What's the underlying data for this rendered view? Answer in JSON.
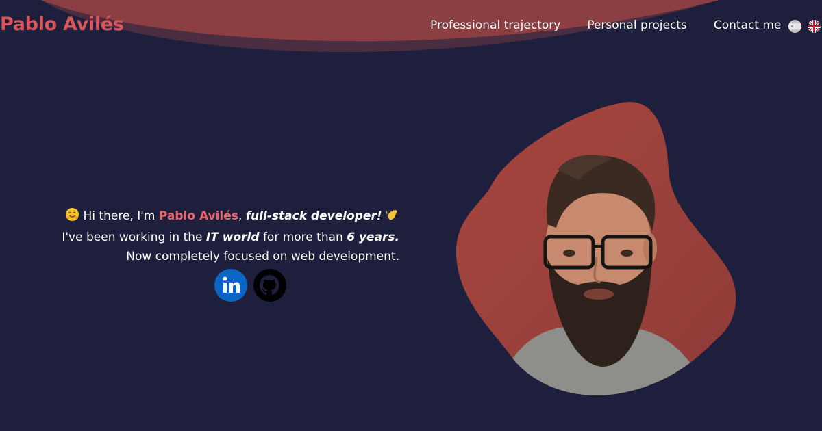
{
  "header": {
    "logo": "Pablo Avilés",
    "nav": [
      {
        "label": "Professional trajectory"
      },
      {
        "label": "Personal projects"
      },
      {
        "label": "Contact me"
      }
    ],
    "languages": [
      {
        "icon": "spain-flag-icon"
      },
      {
        "icon": "uk-flag-icon"
      }
    ]
  },
  "intro": {
    "line1_a": "Hi there, I'm ",
    "line1_name": "Pablo Avilés",
    "line1_b": ", ",
    "line1_role": "full-stack developer!",
    "line2_a": "I've been working in the ",
    "line2_it": "IT world",
    "line2_b": " for more than ",
    "line2_years": "6 years.",
    "line3": "Now completely focused on web development.",
    "emoji_left": "hugging-face-icon",
    "emoji_right": "waving-hand-icon"
  },
  "socials": [
    {
      "icon": "linkedin-icon"
    },
    {
      "icon": "github-icon"
    }
  ],
  "profile": {
    "image": "profile-photo"
  },
  "colors": {
    "background": "#1d1f3c",
    "accent": "#d9575a",
    "blob": "#a0443f",
    "linkedin": "#0a66c2"
  }
}
